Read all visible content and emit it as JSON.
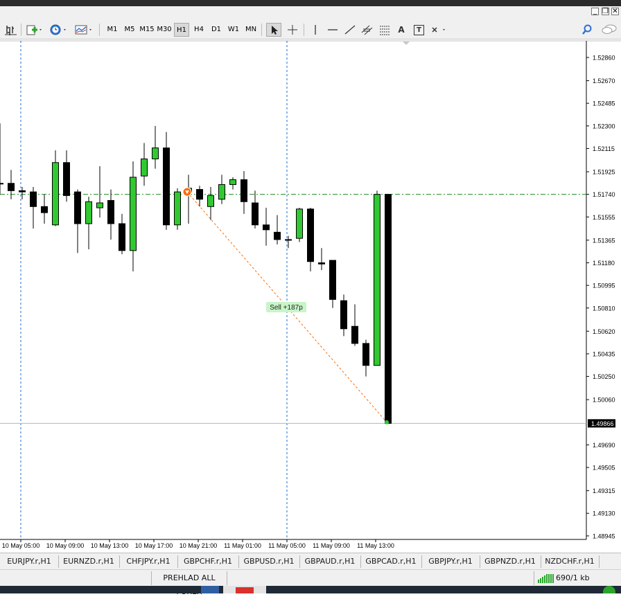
{
  "toolbar": {
    "timeframes": [
      "M1",
      "M5",
      "M15",
      "M30",
      "H1",
      "H4",
      "D1",
      "W1",
      "MN"
    ],
    "active_timeframe": "H1",
    "text_tool": "A",
    "label_tool": "T"
  },
  "chart_data": {
    "type": "candlestick",
    "y_ticks": [
      "1.52860",
      "1.52670",
      "1.52485",
      "1.52300",
      "1.52115",
      "1.51925",
      "1.51740",
      "1.51555",
      "1.51365",
      "1.51180",
      "1.50995",
      "1.50810",
      "1.50620",
      "1.50435",
      "1.50250",
      "1.50060",
      "1.49690",
      "1.49505",
      "1.49315",
      "1.49130",
      "1.48945"
    ],
    "current_price": "1.49866",
    "order_level": 1.5174,
    "x_ticks": [
      "10 May 05:00",
      "10 May 09:00",
      "10 May 13:00",
      "10 May 17:00",
      "10 May 21:00",
      "11 May 01:00",
      "11 May 05:00",
      "11 May 09:00",
      "11 May 13:00"
    ],
    "trade_label": "Sell +187p",
    "trade": {
      "open_price": 1.5176,
      "close_price": 1.49875
    },
    "candles": [
      {
        "o": 1.5183,
        "h": 1.5232,
        "l": 1.5174,
        "c": 1.5183
      },
      {
        "o": 1.5183,
        "h": 1.5194,
        "l": 1.517,
        "c": 1.5177
      },
      {
        "o": 1.5177,
        "h": 1.518,
        "l": 1.517,
        "c": 1.5176
      },
      {
        "o": 1.5176,
        "h": 1.518,
        "l": 1.5146,
        "c": 1.5164
      },
      {
        "o": 1.5164,
        "h": 1.5174,
        "l": 1.515,
        "c": 1.5159
      },
      {
        "o": 1.5149,
        "h": 1.521,
        "l": 1.5148,
        "c": 1.52
      },
      {
        "o": 1.52,
        "h": 1.521,
        "l": 1.5168,
        "c": 1.5173
      },
      {
        "o": 1.5176,
        "h": 1.5178,
        "l": 1.5126,
        "c": 1.515
      },
      {
        "o": 1.515,
        "h": 1.5172,
        "l": 1.5129,
        "c": 1.5168
      },
      {
        "o": 1.5163,
        "h": 1.5197,
        "l": 1.5155,
        "c": 1.5167
      },
      {
        "o": 1.5169,
        "h": 1.5178,
        "l": 1.5137,
        "c": 1.515
      },
      {
        "o": 1.515,
        "h": 1.5158,
        "l": 1.5125,
        "c": 1.5128
      },
      {
        "o": 1.5128,
        "h": 1.5201,
        "l": 1.5111,
        "c": 1.5188
      },
      {
        "o": 1.5189,
        "h": 1.5216,
        "l": 1.5181,
        "c": 1.5203
      },
      {
        "o": 1.5203,
        "h": 1.523,
        "l": 1.5195,
        "c": 1.5212
      },
      {
        "o": 1.5212,
        "h": 1.5225,
        "l": 1.5145,
        "c": 1.5149
      },
      {
        "o": 1.5149,
        "h": 1.5179,
        "l": 1.5145,
        "c": 1.5176
      },
      {
        "o": 1.5176,
        "h": 1.519,
        "l": 1.515,
        "c": 1.5179
      },
      {
        "o": 1.5178,
        "h": 1.5181,
        "l": 1.5164,
        "c": 1.517
      },
      {
        "o": 1.5164,
        "h": 1.518,
        "l": 1.5153,
        "c": 1.5173
      },
      {
        "o": 1.517,
        "h": 1.519,
        "l": 1.5166,
        "c": 1.5182
      },
      {
        "o": 1.5182,
        "h": 1.5188,
        "l": 1.5178,
        "c": 1.5186
      },
      {
        "o": 1.5186,
        "h": 1.5193,
        "l": 1.5158,
        "c": 1.5168
      },
      {
        "o": 1.5167,
        "h": 1.5177,
        "l": 1.5146,
        "c": 1.5149
      },
      {
        "o": 1.5149,
        "h": 1.5163,
        "l": 1.5132,
        "c": 1.5145
      },
      {
        "o": 1.5143,
        "h": 1.5157,
        "l": 1.5133,
        "c": 1.5137
      },
      {
        "o": 1.5137,
        "h": 1.514,
        "l": 1.513,
        "c": 1.5137
      },
      {
        "o": 1.5138,
        "h": 1.5163,
        "l": 1.5135,
        "c": 1.5162
      },
      {
        "o": 1.5162,
        "h": 1.5163,
        "l": 1.5111,
        "c": 1.5119
      },
      {
        "o": 1.5118,
        "h": 1.513,
        "l": 1.5112,
        "c": 1.5117
      },
      {
        "o": 1.512,
        "h": 1.512,
        "l": 1.5081,
        "c": 1.5088
      },
      {
        "o": 1.5087,
        "h": 1.5092,
        "l": 1.5058,
        "c": 1.5064
      },
      {
        "o": 1.5066,
        "h": 1.5084,
        "l": 1.505,
        "c": 1.5052
      },
      {
        "o": 1.5052,
        "h": 1.5055,
        "l": 1.5025,
        "c": 1.5034
      },
      {
        "o": 1.5034,
        "h": 1.5177,
        "l": 1.5034,
        "c": 1.5174
      },
      {
        "o": 1.5174,
        "h": 1.5174,
        "l": 1.49866,
        "c": 1.49866
      }
    ]
  },
  "tabs": [
    "EURJPY.r,H1",
    "EURNZD.r,H1",
    "CHFJPY.r,H1",
    "GBPCHF.r,H1",
    "GBPUSD.r,H1",
    "GBPAUD.r,H1",
    "GBPCAD.r,H1",
    "GBPJPY.r,H1",
    "GBPNZD.r,H1",
    "NZDCHF.r,H1"
  ],
  "status": {
    "profile": "PREHLAD ALL FOREX",
    "traffic": "690/1 kb"
  },
  "colors": {
    "bull": "#32c832",
    "bear": "#000000",
    "order_line": "#1e8c1e",
    "trade_line": "#ff6a00",
    "period_sep": "#1e6ec8",
    "label_bg": "#c8f5c8"
  }
}
